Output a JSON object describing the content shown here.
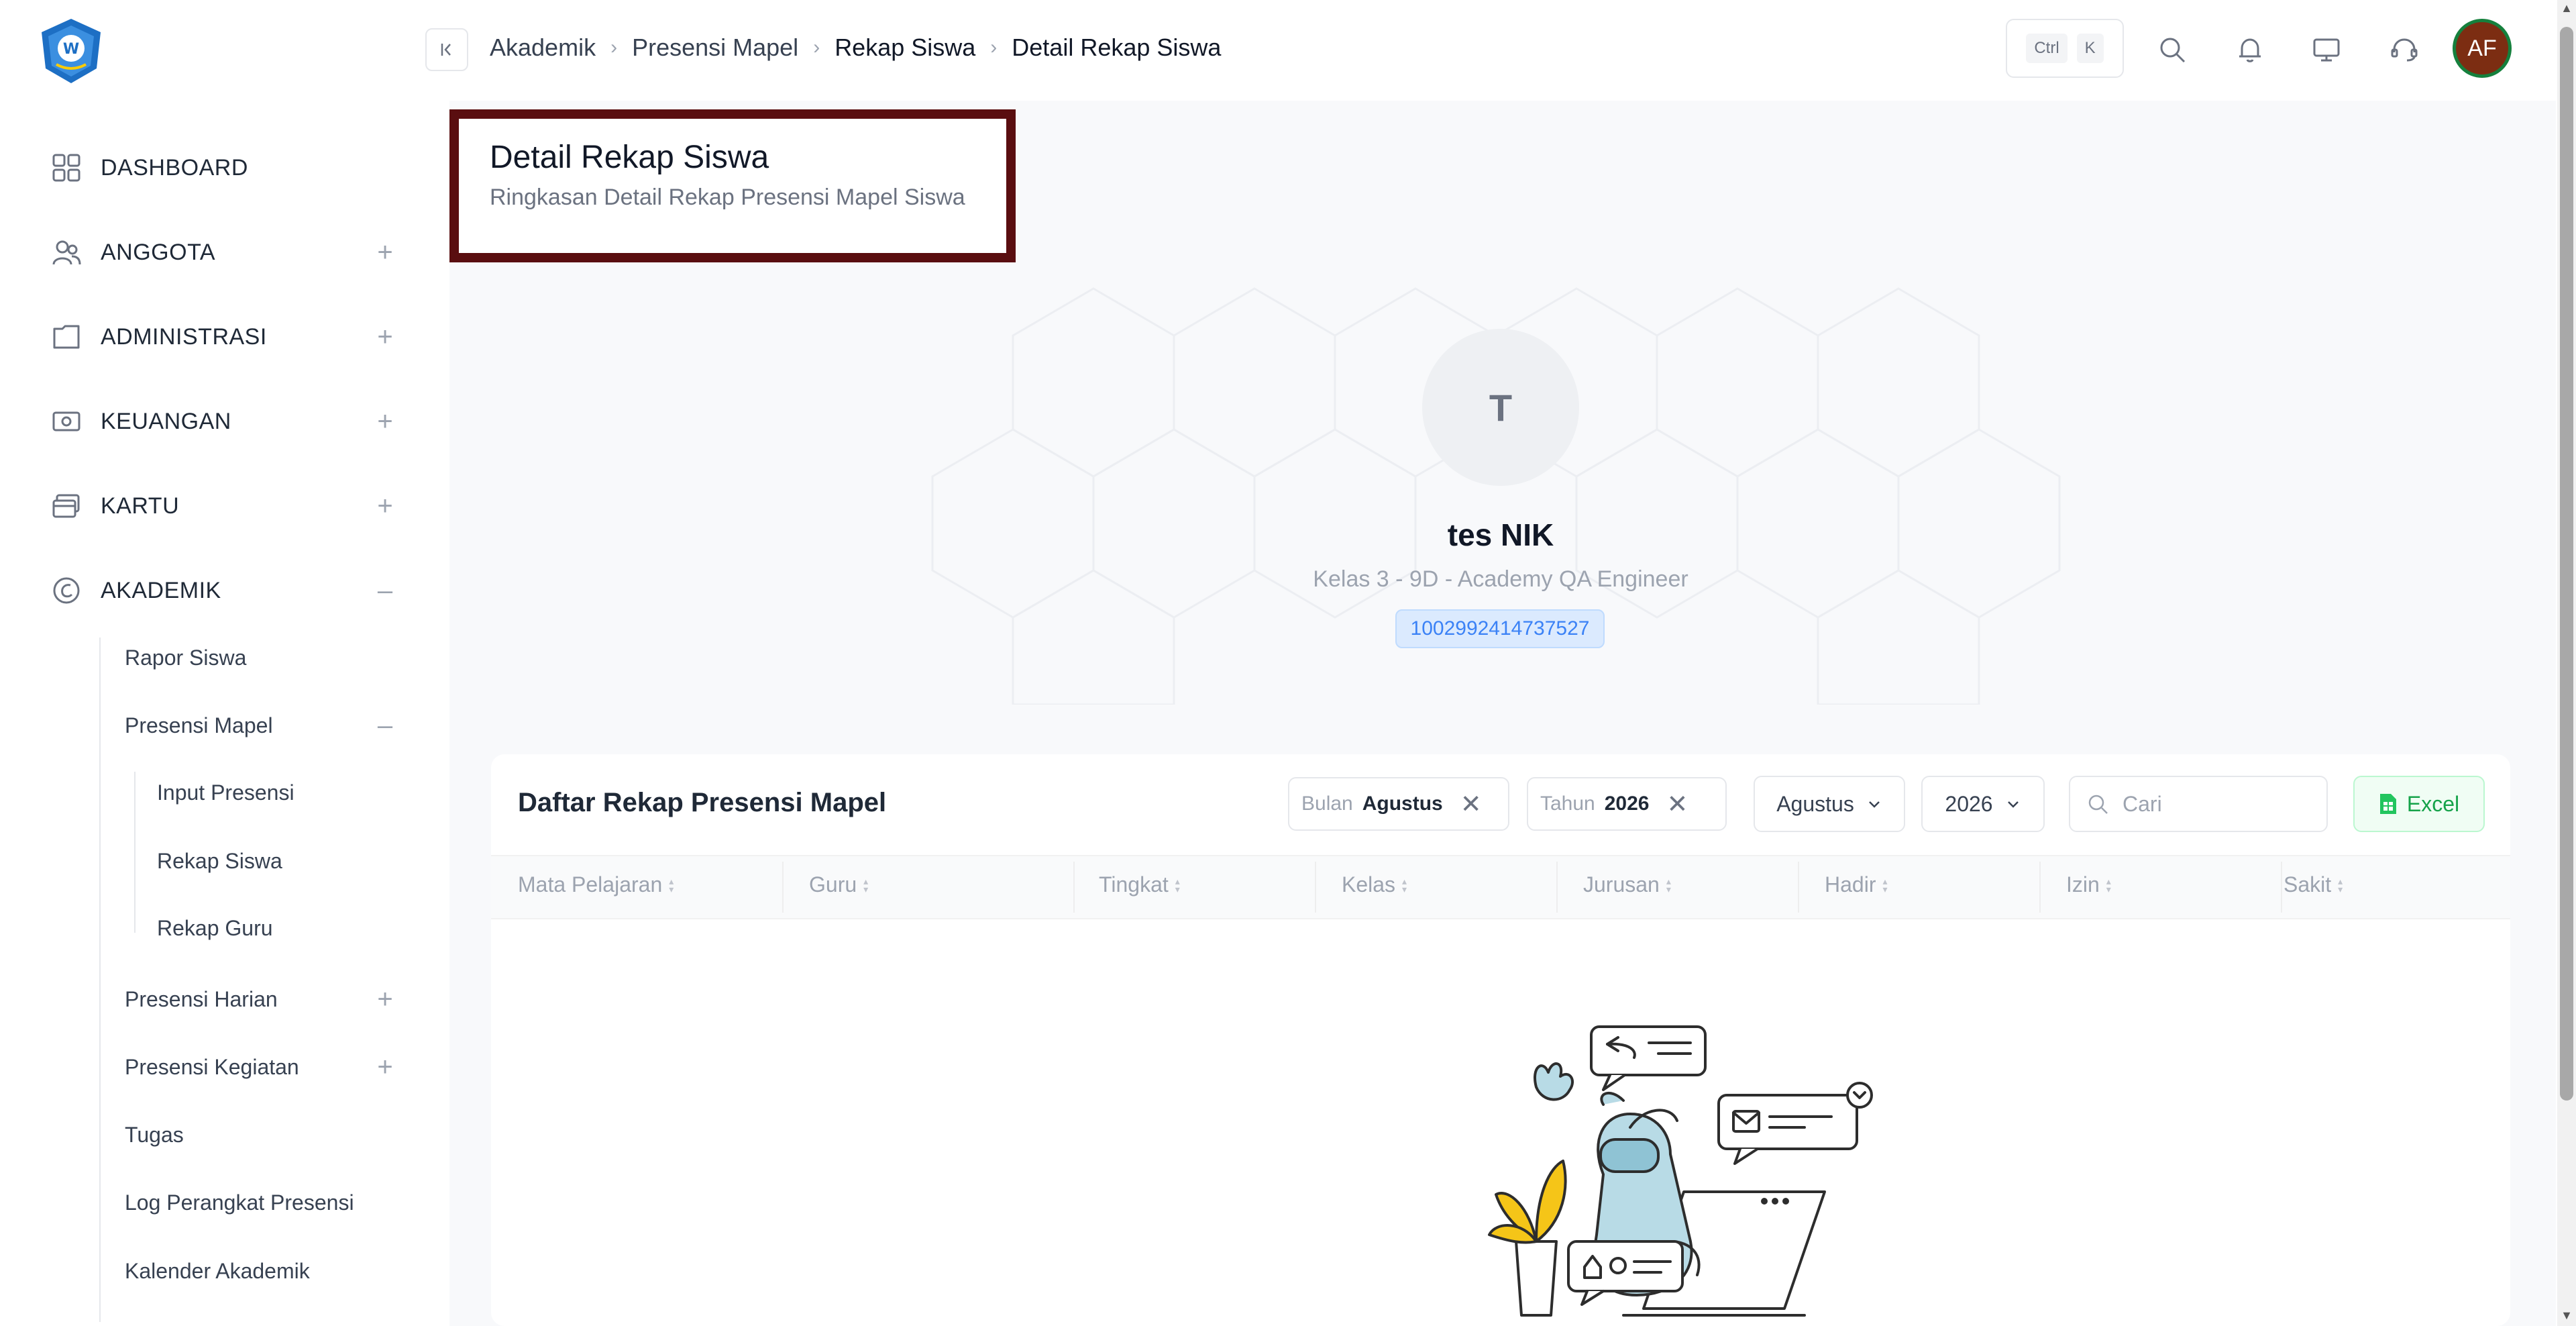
{
  "sidebar": {
    "items": [
      {
        "label": "DASHBOARD",
        "icon": "dashboard-grid-icon",
        "toggle": ""
      },
      {
        "label": "ANGGOTA",
        "icon": "users-icon",
        "toggle": "+"
      },
      {
        "label": "ADMINISTRASI",
        "icon": "folder-icon",
        "toggle": "+"
      },
      {
        "label": "KEUANGAN",
        "icon": "money-icon",
        "toggle": "+"
      },
      {
        "label": "KARTU",
        "icon": "card-icon",
        "toggle": "+"
      },
      {
        "label": "AKADEMIK",
        "icon": "academic-icon",
        "toggle": "–"
      }
    ],
    "akademik_sub": [
      {
        "label": "Rapor Siswa",
        "toggle": ""
      },
      {
        "label": "Presensi Mapel",
        "toggle": "–"
      },
      {
        "label": "Presensi Harian",
        "toggle": "+"
      },
      {
        "label": "Presensi Kegiatan",
        "toggle": "+"
      },
      {
        "label": "Tugas",
        "toggle": ""
      },
      {
        "label": "Log Perangkat Presensi",
        "toggle": ""
      },
      {
        "label": "Kalender Akademik",
        "toggle": ""
      }
    ],
    "presensi_mapel_sub": [
      "Input Presensi",
      "Rekap Siswa",
      "Rekap Guru"
    ]
  },
  "breadcrumb": [
    "Akademik",
    "Presensi Mapel",
    "Rekap Siswa",
    "Detail Rekap Siswa"
  ],
  "topbar": {
    "kbd_ctrl": "Ctrl",
    "kbd_k": "K",
    "avatar_initials": "AF"
  },
  "page": {
    "title": "Detail Rekap Siswa",
    "subtitle": "Ringkasan Detail Rekap Presensi Mapel Siswa"
  },
  "profile": {
    "initial": "T",
    "name": "tes NIK",
    "class": "Kelas 3 - 9D - Academy QA Engineer",
    "nik": "1002992414737527"
  },
  "table_card": {
    "title": "Daftar Rekap Presensi Mapel",
    "filters": [
      {
        "key": "Bulan",
        "value": "Agustus"
      },
      {
        "key": "Tahun",
        "value": "2026"
      }
    ],
    "month_select": "Agustus",
    "year_select": "2026",
    "search_placeholder": "Cari",
    "excel_label": "Excel",
    "columns": [
      "Mata Pelajaran",
      "Guru",
      "Tingkat",
      "Kelas",
      "Jurusan",
      "Hadir",
      "Izin",
      "Sakit"
    ]
  },
  "colors": {
    "highlight_border": "#5a0e10",
    "accent_blue": "#3b82f6",
    "excel_green": "#16a34a"
  }
}
